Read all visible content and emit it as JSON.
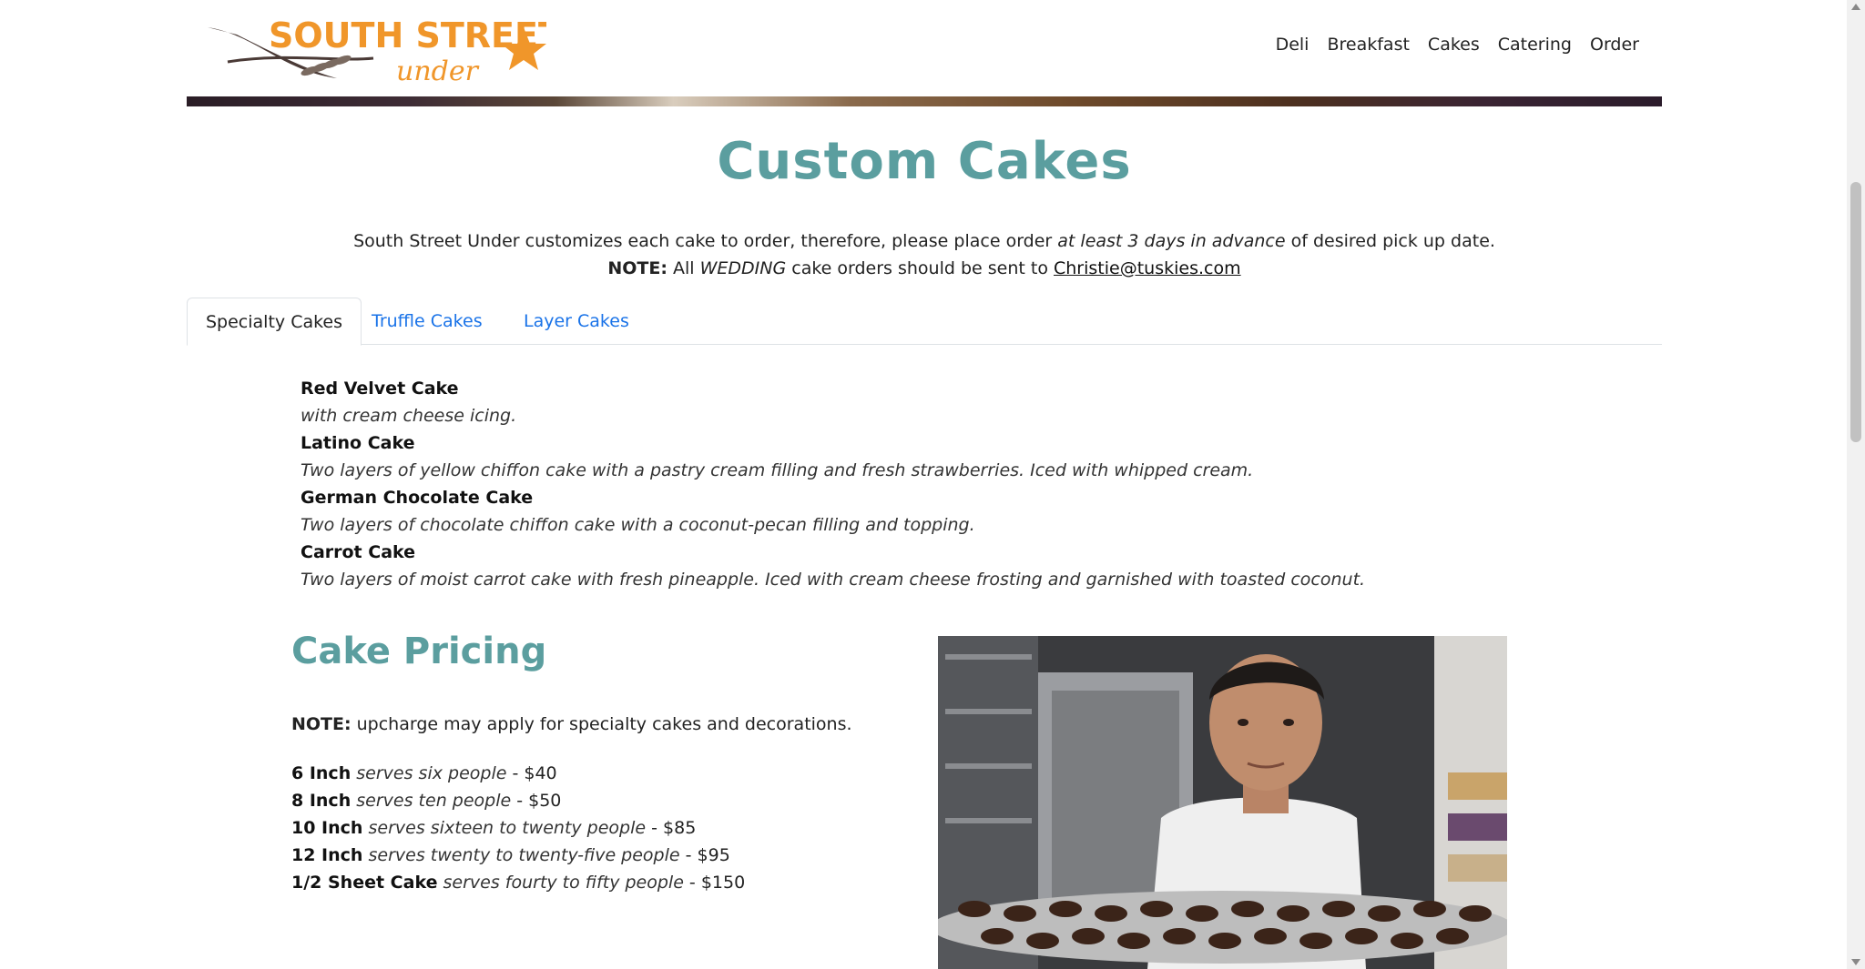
{
  "logo": {
    "line1": "SOUTH STREET",
    "line2": "under"
  },
  "nav": [
    "Deli",
    "Breakfast",
    "Cakes",
    "Catering",
    "Order"
  ],
  "page_title": "Custom Cakes",
  "intro": {
    "text_before": "South Street Under customizes each cake to order, therefore, please place order ",
    "emphasis": "at least 3 days in advance",
    "text_after": " of desired pick up date.",
    "note_label": "NOTE:",
    "note_before": " All ",
    "note_emphasis": "WEDDING",
    "note_after": " cake orders should be sent to ",
    "email": "Christie@tuskies.com"
  },
  "tabs": [
    {
      "label": "Specialty Cakes",
      "active": true
    },
    {
      "label": "Truffle Cakes",
      "active": false
    },
    {
      "label": "Layer Cakes",
      "active": false
    }
  ],
  "cakes": [
    {
      "name": "Red Velvet Cake",
      "desc": "with cream cheese icing."
    },
    {
      "name": "Latino Cake",
      "desc": "Two layers of yellow chiffon cake with a pastry cream filling and fresh strawberries. Iced with whipped cream."
    },
    {
      "name": "German Chocolate Cake",
      "desc": "Two layers of chocolate chiffon cake with a coconut-pecan filling and topping."
    },
    {
      "name": "Carrot Cake",
      "desc": "Two layers of moist carrot cake with fresh pineapple. Iced with cream cheese frosting and garnished with toasted coconut."
    }
  ],
  "pricing": {
    "title": "Cake Pricing",
    "note_label": "NOTE:",
    "note_text": " upcharge may apply for specialty cakes and decorations.",
    "items": [
      {
        "size": "6 Inch",
        "serves": "serves six people",
        "price": "$40"
      },
      {
        "size": "8 Inch",
        "serves": "serves ten people",
        "price": "$50"
      },
      {
        "size": "10 Inch",
        "serves": "serves sixteen to twenty people",
        "price": "$85"
      },
      {
        "size": "12 Inch",
        "serves": "serves twenty to twenty-five people",
        "price": "$95"
      },
      {
        "size": "1/2 Sheet Cake",
        "serves": "serves fourty to fifty people",
        "price": "$150"
      }
    ]
  },
  "colors": {
    "accent": "#5b9e9f",
    "logo_orange": "#f0962a",
    "link": "#1a73e8"
  }
}
